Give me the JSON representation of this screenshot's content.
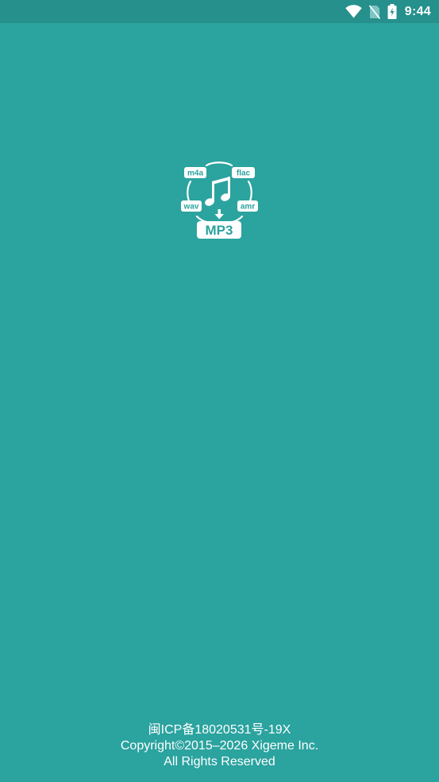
{
  "colors": {
    "background": "#2ba39f",
    "status_bar": "#25908c",
    "foreground": "#ffffff"
  },
  "status_bar": {
    "time": "9:44",
    "icons": [
      "wifi-icon",
      "no-sim-icon",
      "battery-charging-icon"
    ]
  },
  "logo": {
    "icon": "music-note-icon",
    "formats": [
      "m4a",
      "flac",
      "wav",
      "amr"
    ],
    "target_format": "MP3"
  },
  "footer": {
    "license": "闽ICP备18020531号-19X",
    "copyright": "Copyright©2015–2026 Xigeme Inc.",
    "rights": "All Rights Reserved"
  }
}
